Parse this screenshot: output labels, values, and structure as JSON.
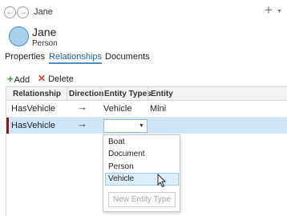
{
  "header": {
    "title": "Jane",
    "back_icon": "arrow-left",
    "forward_icon": "arrow-right",
    "add_icon": "plus",
    "add_caret_icon": "caret-down"
  },
  "entity": {
    "name": "Jane",
    "type": "Person",
    "avatar_color": "#a8d0ec"
  },
  "tabs": [
    {
      "label": "Properties",
      "active": false
    },
    {
      "label": "Relationships",
      "active": true
    },
    {
      "label": "Documents",
      "active": false
    }
  ],
  "toolbar": {
    "add_label": "Add",
    "delete_label": "Delete"
  },
  "grid": {
    "columns": [
      "Relationship",
      "Direction",
      "Entity Types",
      "Entity"
    ],
    "rows": [
      {
        "relationship": "HasVehicle",
        "direction": "→",
        "entity_types": "Vehicle",
        "entity": "Mini",
        "selected": false
      },
      {
        "relationship": "HasVehicle",
        "direction": "→",
        "entity_types": "",
        "entity": "",
        "selected": true
      }
    ]
  },
  "entity_type_dropdown": {
    "current_value": "",
    "options": [
      "Boat",
      "Document",
      "Person",
      "Vehicle"
    ],
    "hovered_option": "Vehicle",
    "new_button_label": "New Entity Type"
  },
  "colors": {
    "accent": "#1f5fa8",
    "selected_row": "#cfe6f8",
    "row_marker": "#8b1a1a",
    "add_icon": "#3a9a3a",
    "delete_icon": "#d0402a"
  }
}
